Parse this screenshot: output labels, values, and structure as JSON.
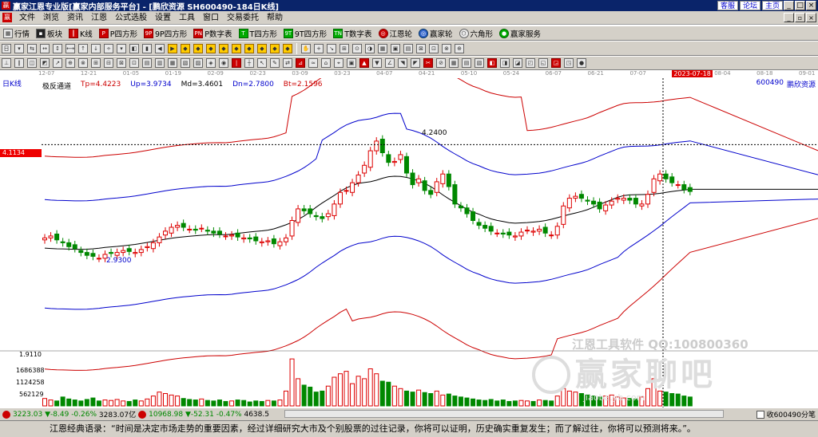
{
  "titlebar": {
    "title": "赢家江恩专业版[赢家内部服务平台] - [鹏欣资源  SH600490-184日K线]",
    "links": [
      "客服",
      "论坛",
      "主页"
    ]
  },
  "menu": [
    "文件",
    "浏览",
    "资讯",
    "江恩",
    "公式选股",
    "设置",
    "工具",
    "窗口",
    "交易委托",
    "帮助"
  ],
  "toolbar1": [
    {
      "icon": "grid-icon",
      "label": "行情"
    },
    {
      "icon": "blocks-icon",
      "label": "板块"
    },
    {
      "icon": "candle-icon",
      "label": "K线"
    },
    {
      "icon": "p-square-icon",
      "label": "P四方形"
    },
    {
      "icon": "9p-square-icon",
      "label": "9P四方形"
    },
    {
      "icon": "pn-icon",
      "label": "P数字表"
    },
    {
      "icon": "t-square-icon",
      "label": "T四方形"
    },
    {
      "icon": "9t-square-icon",
      "label": "9T四方形"
    },
    {
      "icon": "tn-icon",
      "label": "T数字表"
    },
    {
      "icon": "gann-wheel-icon",
      "label": "江恩轮"
    },
    {
      "icon": "winner-wheel-icon",
      "label": "赢家轮"
    },
    {
      "icon": "hexagon-icon",
      "label": "六角形"
    },
    {
      "icon": "service-icon",
      "label": "赢家服务"
    }
  ],
  "chart_header": {
    "period": "日K线",
    "indicator": "极反通道",
    "tp": "Tp=4.4223",
    "up": "Up=3.9734",
    "md": "Md=3.4601",
    "dn": "Dn=2.7800",
    "bt": "Bt=2.1596",
    "code": "600490",
    "name": "鹏欣资源",
    "cursor_price": "4.1134",
    "high_label": "4.2400",
    "low_label": "2.9300"
  },
  "date_axis": [
    "12-07",
    "12-21",
    "01-05",
    "01-19",
    "02-09",
    "02-23",
    "03-09",
    "03-23",
    "04-07",
    "04-21",
    "05-10",
    "05-24",
    "06-07",
    "06-21",
    "07-07",
    "2023-07-18",
    "08-04",
    "08-18",
    "09-01"
  ],
  "volume_axis": [
    "1.9110",
    "1686388",
    "1124258",
    "562129"
  ],
  "watermark": {
    "line1": "江恩工具软件  QQ:100800360",
    "line2": "赢家聊吧",
    "line3": "jiaoba.yb.com"
  },
  "status": {
    "sh_index": "3223.03",
    "sh_change": "▼-8.49",
    "sh_pct": "-0.26%",
    "sh_amount": "3283.07亿",
    "sz_index": "10968.98",
    "sz_change": "▼-52.31",
    "sz_pct": "-0.47%",
    "sz_amount": "4638.5",
    "right_label": "收600490分笔"
  },
  "quote": "江恩经典语录：“时间是决定市场走势的重要因素，经过详细研究大市及个别股票的过往记录，你将可以证明，历史确实重复发生；而了解过往，你将可以预测将来。”。",
  "chart_data": {
    "type": "candlestick",
    "title": "鹏欣资源 600490 日K线",
    "x_range": [
      "12-07",
      "09-01"
    ],
    "y_range": [
      2.0,
      4.8
    ],
    "marks": {
      "high": 4.24,
      "low": 2.93,
      "cursor": 4.1134
    },
    "series": [
      {
        "name": "Tp",
        "color": "#c00",
        "last": 4.4223
      },
      {
        "name": "Up",
        "color": "#00c",
        "last": 3.9734
      },
      {
        "name": "Md",
        "color": "#000",
        "last": 3.4601
      },
      {
        "name": "Dn",
        "color": "#00c",
        "last": 2.78
      },
      {
        "name": "Bt",
        "color": "#c00",
        "last": 2.1596
      }
    ],
    "closes": [
      3.15,
      3.17,
      3.13,
      3.1,
      3.06,
      3.04,
      3.0,
      2.97,
      2.96,
      2.94,
      2.98,
      2.99,
      3.0,
      3.02,
      3.01,
      3.0,
      3.03,
      3.06,
      3.1,
      3.16,
      3.22,
      3.26,
      3.28,
      3.26,
      3.24,
      3.23,
      3.25,
      3.22,
      3.2,
      3.19,
      3.17,
      3.18,
      3.16,
      3.15,
      3.14,
      3.12,
      3.11,
      3.12,
      3.09,
      3.11,
      3.15,
      3.33,
      3.45,
      3.43,
      3.4,
      3.37,
      3.35,
      3.4,
      3.5,
      3.62,
      3.64,
      3.72,
      3.8,
      3.9,
      4.05,
      4.15,
      4.03,
      3.93,
      3.94,
      4.01,
      3.82,
      3.7,
      3.76,
      3.64,
      3.6,
      3.73,
      3.81,
      3.68,
      3.5,
      3.46,
      3.4,
      3.33,
      3.28,
      3.25,
      3.22,
      3.2,
      3.19,
      3.18,
      3.17,
      3.21,
      3.23,
      3.22,
      3.24,
      3.2,
      3.18,
      3.27,
      3.48,
      3.56,
      3.58,
      3.56,
      3.53,
      3.5,
      3.45,
      3.49,
      3.53,
      3.56,
      3.56,
      3.54,
      3.5,
      3.5,
      3.6,
      3.76,
      3.81,
      3.76,
      3.72,
      3.7,
      3.65,
      3.63
    ],
    "volumes": [
      0.15,
      0.12,
      0.1,
      0.18,
      0.14,
      0.12,
      0.1,
      0.13,
      0.16,
      0.1,
      0.12,
      0.11,
      0.13,
      0.1,
      0.09,
      0.12,
      0.1,
      0.14,
      0.2,
      0.28,
      0.25,
      0.22,
      0.2,
      0.15,
      0.13,
      0.12,
      0.14,
      0.11,
      0.1,
      0.12,
      0.09,
      0.1,
      0.12,
      0.11,
      0.08,
      0.1,
      0.09,
      0.11,
      0.1,
      0.12,
      0.3,
      0.95,
      0.55,
      0.42,
      0.38,
      0.28,
      0.3,
      0.4,
      0.58,
      0.65,
      0.7,
      0.45,
      0.6,
      0.55,
      0.75,
      0.65,
      0.5,
      0.48,
      0.4,
      0.35,
      0.3,
      0.28,
      0.32,
      0.27,
      0.25,
      0.3,
      0.22,
      0.24,
      0.2,
      0.18,
      0.16,
      0.14,
      0.12,
      0.11,
      0.13,
      0.1,
      0.12,
      0.09,
      0.1,
      0.11,
      0.1,
      0.09,
      0.12,
      0.11,
      0.1,
      0.2,
      0.35,
      0.3,
      0.28,
      0.25,
      0.22,
      0.2,
      0.18,
      0.2,
      0.22,
      0.18,
      0.16,
      0.15,
      0.14,
      0.18,
      0.35,
      0.55,
      0.3,
      0.28,
      0.25,
      0.24,
      0.2,
      0.18
    ]
  }
}
